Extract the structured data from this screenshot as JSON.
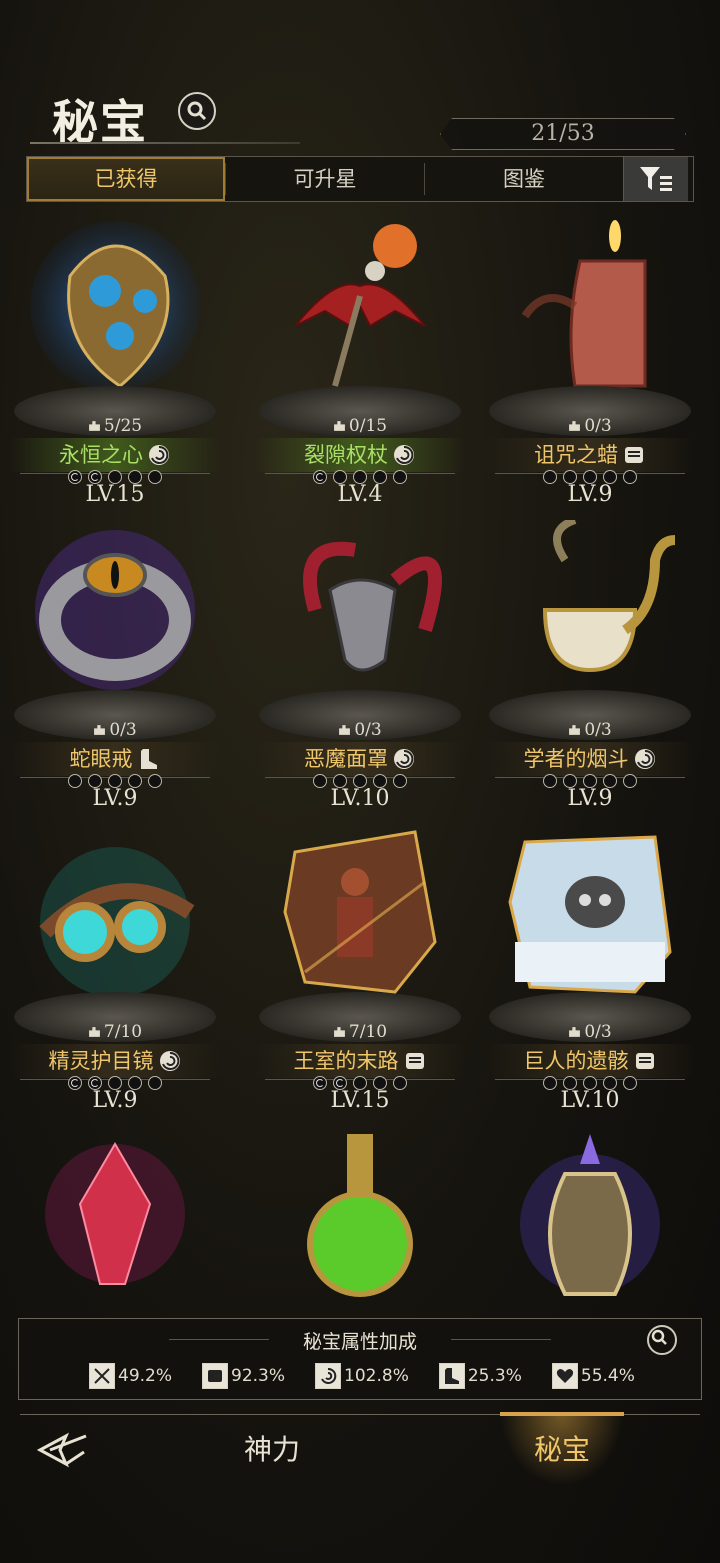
{
  "header": {
    "title": "秘宝",
    "counter": "21/53"
  },
  "tabs": [
    {
      "label": "已获得",
      "active": true
    },
    {
      "label": "可升星",
      "active": false
    },
    {
      "label": "图鉴",
      "active": false
    }
  ],
  "items": [
    {
      "name": "永恒之心",
      "count": "5/25",
      "level": "LV.15",
      "rarity": "green",
      "type_icon": "swirl-icon",
      "stars": 2
    },
    {
      "name": "裂隙权杖",
      "count": "0/15",
      "level": "LV.4",
      "rarity": "green",
      "type_icon": "swirl-icon",
      "stars": 1
    },
    {
      "name": "诅咒之蜡",
      "count": "0/3",
      "level": "LV.9",
      "rarity": "gold",
      "type_icon": "fist-icon",
      "stars": 0
    },
    {
      "name": "蛇眼戒",
      "count": "0/3",
      "level": "LV.9",
      "rarity": "gold",
      "type_icon": "boot-icon",
      "stars": 0
    },
    {
      "name": "恶魔面罩",
      "count": "0/3",
      "level": "LV.10",
      "rarity": "gold",
      "type_icon": "swirl-icon",
      "stars": 0
    },
    {
      "name": "学者的烟斗",
      "count": "0/3",
      "level": "LV.9",
      "rarity": "gold",
      "type_icon": "swirl-icon",
      "stars": 0
    },
    {
      "name": "精灵护目镜",
      "count": "7/10",
      "level": "LV.9",
      "rarity": "gold",
      "type_icon": "swirl-icon",
      "stars": 2
    },
    {
      "name": "王室的末路",
      "count": "7/10",
      "level": "LV.15",
      "rarity": "gold",
      "type_icon": "fist-icon",
      "stars": 2
    },
    {
      "name": "巨人的遗骸",
      "count": "0/3",
      "level": "LV.10",
      "rarity": "gold",
      "type_icon": "fist-icon",
      "stars": 0
    },
    {
      "name": "",
      "count": "",
      "level": "",
      "rarity": "none",
      "type_icon": "",
      "stars": -1
    },
    {
      "name": "",
      "count": "",
      "level": "",
      "rarity": "none",
      "type_icon": "",
      "stars": -1
    },
    {
      "name": "",
      "count": "",
      "level": "",
      "rarity": "none",
      "type_icon": "",
      "stars": -1
    }
  ],
  "bonus": {
    "title": "秘宝属性加成",
    "stats": [
      {
        "icon": "swords-icon",
        "value": "49.2%"
      },
      {
        "icon": "fist-icon",
        "value": "92.3%"
      },
      {
        "icon": "swirl-icon",
        "value": "102.8%"
      },
      {
        "icon": "boot-icon",
        "value": "25.3%"
      },
      {
        "icon": "heart-icon",
        "value": "55.4%"
      }
    ]
  },
  "nav": {
    "divine_power": "神力",
    "treasure": "秘宝"
  },
  "colors": {
    "accent_gold": "#f0c66a",
    "rarity_green": "#a9e065"
  }
}
